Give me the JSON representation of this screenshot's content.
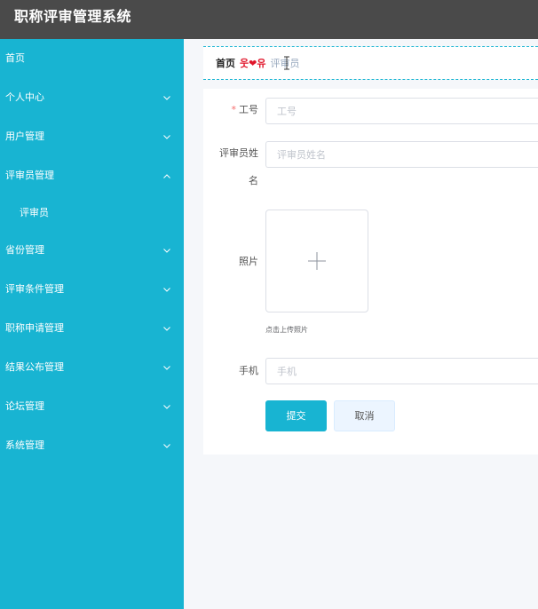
{
  "app": {
    "title": "职称评审管理系统"
  },
  "sidebar": {
    "items": [
      {
        "label": "首页",
        "chevron": "none"
      },
      {
        "label": "个人中心",
        "chevron": "down"
      },
      {
        "label": "用户管理",
        "chevron": "down"
      },
      {
        "label": "评审员管理",
        "chevron": "up"
      },
      {
        "label": "评审员",
        "chevron": "none",
        "sub": true
      },
      {
        "label": "省份管理",
        "chevron": "down"
      },
      {
        "label": "评审条件管理",
        "chevron": "down"
      },
      {
        "label": "职称申请管理",
        "chevron": "down"
      },
      {
        "label": "结果公布管理",
        "chevron": "down"
      },
      {
        "label": "论坛管理",
        "chevron": "down"
      },
      {
        "label": "系统管理",
        "chevron": "down"
      }
    ]
  },
  "breadcrumb": {
    "home": "首页",
    "separator": "웃❤유",
    "current": "评审员"
  },
  "form": {
    "employee_id": {
      "label": "工号",
      "placeholder": "工号",
      "value": ""
    },
    "name": {
      "label_line1": "评审员姓",
      "label_line2": "名",
      "placeholder": "评审员姓名",
      "value": ""
    },
    "photo": {
      "label": "照片",
      "hint": "点击上传照片"
    },
    "phone": {
      "label": "手机",
      "placeholder": "手机",
      "value": ""
    },
    "submit_label": "提交",
    "cancel_label": "取消"
  },
  "colors": {
    "accent": "#18b4d2",
    "header": "#4a4a4a",
    "required": "#f56c6c",
    "heart": "#e0162b"
  },
  "icons": [
    "chevron-down-icon",
    "chevron-up-icon",
    "plus-icon",
    "text-cursor-icon"
  ]
}
